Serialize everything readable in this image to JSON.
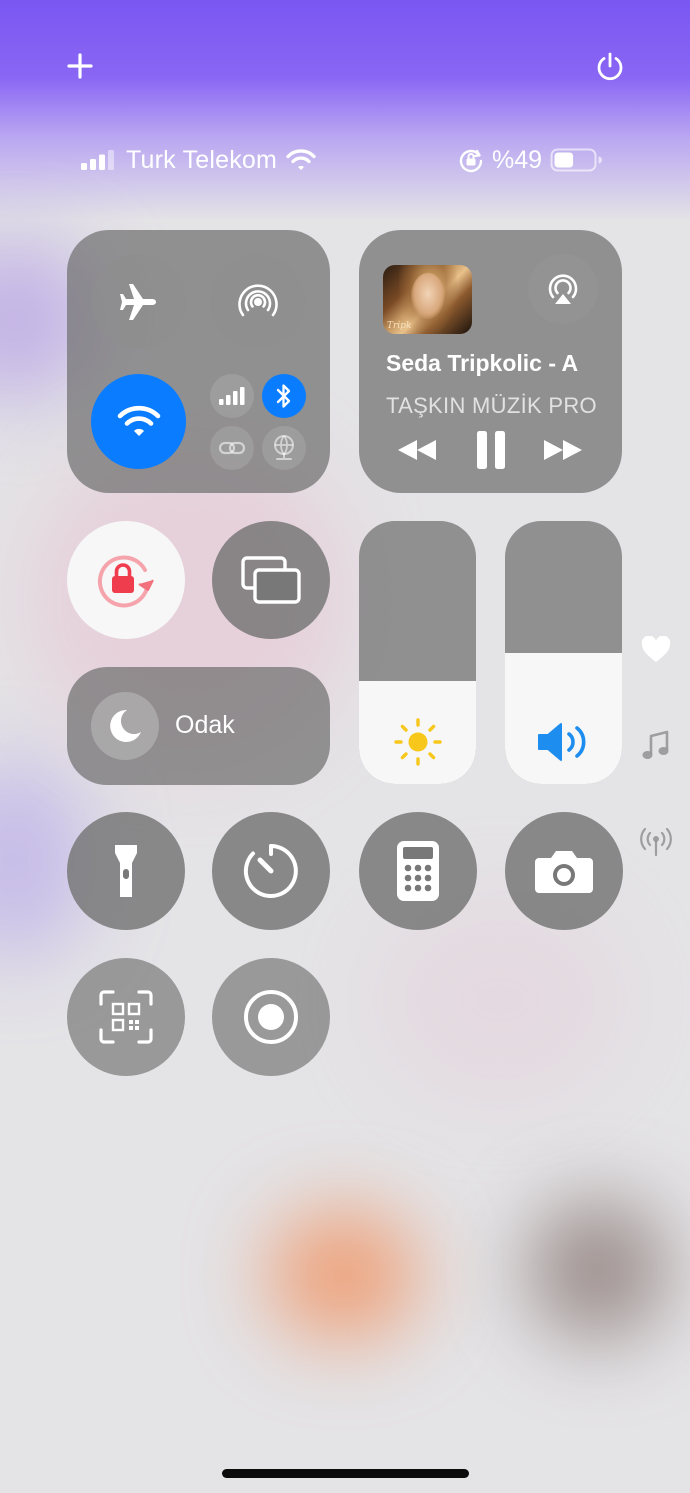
{
  "status_bar": {
    "carrier": "Turk Telekom",
    "battery_percent": "%49",
    "signal_bars": 3,
    "battery_level": 0.49
  },
  "top_controls": {
    "add_icon": "plus-icon",
    "power_icon": "power-icon"
  },
  "connectivity": {
    "airplane_mode": false,
    "airdrop": false,
    "wifi": true,
    "cellular": false,
    "bluetooth": true,
    "hotspot": false,
    "vpn": false
  },
  "now_playing": {
    "title": "Seda Tripkolic - A",
    "artist": "TAŞKIN MÜZİK PRO",
    "album_art_caption": "Tripk",
    "state": "playing"
  },
  "tiles": {
    "orientation_lock": "on",
    "screen_mirroring": "off"
  },
  "brightness": {
    "level": 0.39
  },
  "volume": {
    "level": 0.5
  },
  "focus": {
    "label": "Odak"
  },
  "side_pages": [
    "heart-icon",
    "music-note-icon",
    "antenna-icon"
  ],
  "colors": {
    "accent_blue": "#0a7cff",
    "lock_red": "#ef3d4e",
    "sun_yellow": "#f7c71b",
    "speaker_blue": "#1e8df0",
    "header_purple": "#7a57f2"
  }
}
